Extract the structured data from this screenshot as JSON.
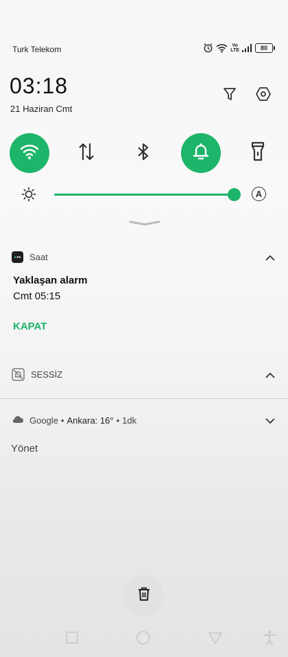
{
  "status_bar": {
    "carrier": "Turk Telekom",
    "volte_top": "Vo",
    "volte_bottom": "LTE",
    "battery": "80",
    "icons": [
      "alarm-icon",
      "wifi-icon",
      "volte-icon",
      "signal-icon",
      "battery-icon"
    ]
  },
  "header": {
    "time": "03:18",
    "date": "21 Haziran Cmt",
    "icons": [
      "filter-icon",
      "settings-icon"
    ]
  },
  "quick_toggles": [
    {
      "name": "wifi",
      "icon": "wifi-icon",
      "on": true
    },
    {
      "name": "mobile-data",
      "icon": "data-arrows-icon",
      "on": false
    },
    {
      "name": "bluetooth",
      "icon": "bluetooth-icon",
      "on": false
    },
    {
      "name": "sound",
      "icon": "bell-icon",
      "on": true
    },
    {
      "name": "flashlight",
      "icon": "flashlight-icon",
      "on": false
    }
  ],
  "brightness": {
    "level": 1.0,
    "auto_label": "A"
  },
  "colors": {
    "accent": "#1db56a"
  },
  "notifications": {
    "clock": {
      "app": "Saat",
      "title": "Yaklaşan alarm",
      "text": "Cmt 05:15",
      "action": "KAPAT"
    },
    "silent": {
      "label": "SESSİZ"
    },
    "google": {
      "app": "Google",
      "sep1": "•",
      "detail": "Ankara: 16°",
      "sep2": "•",
      "age": "1dk"
    },
    "manage": "Yönet"
  },
  "nav_bar": [
    "recents-icon",
    "home-icon",
    "back-icon",
    "accessibility-icon"
  ]
}
